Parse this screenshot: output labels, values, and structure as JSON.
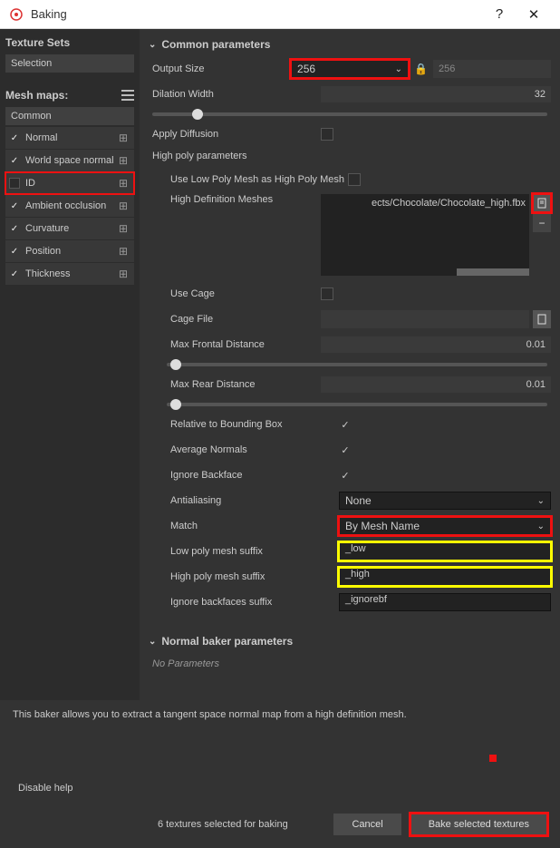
{
  "window": {
    "title": "Baking"
  },
  "sidebar": {
    "texture_sets_label": "Texture Sets",
    "selection": "Selection",
    "meshmaps_label": "Mesh maps:",
    "group_label": "Common",
    "maps": [
      {
        "label": "Normal",
        "checked": true
      },
      {
        "label": "World space normal",
        "checked": true
      },
      {
        "label": "ID",
        "checked": false
      },
      {
        "label": "Ambient occlusion",
        "checked": true
      },
      {
        "label": "Curvature",
        "checked": true
      },
      {
        "label": "Position",
        "checked": true
      },
      {
        "label": "Thickness",
        "checked": true
      }
    ]
  },
  "sections": {
    "common_params": "Common parameters",
    "normal_baker": "Normal baker parameters",
    "no_params": "No Parameters"
  },
  "params": {
    "output_size_label": "Output Size",
    "output_size_value": "256",
    "output_size_locked": "256",
    "dilation_label": "Dilation Width",
    "dilation_value": "32",
    "apply_diffusion_label": "Apply Diffusion",
    "high_poly_params": "High poly parameters",
    "use_low_as_high_label": "Use Low Poly Mesh as High Poly Mesh",
    "high_def_meshes_label": "High Definition Meshes",
    "mesh_path_display": "ects/Chocolate/Chocolate_high.fbx",
    "use_cage_label": "Use Cage",
    "cage_file_label": "Cage File",
    "max_frontal_label": "Max Frontal Distance",
    "max_frontal_value": "0.01",
    "max_rear_label": "Max Rear Distance",
    "max_rear_value": "0.01",
    "relative_bb_label": "Relative to Bounding Box",
    "relative_bb_checked": true,
    "avg_normals_label": "Average Normals",
    "avg_normals_checked": true,
    "ignore_backface_label": "Ignore Backface",
    "ignore_backface_checked": true,
    "antialiasing_label": "Antialiasing",
    "antialiasing_value": "None",
    "match_label": "Match",
    "match_value": "By Mesh Name",
    "low_suffix_label": "Low poly mesh suffix",
    "low_suffix_value": "_low",
    "high_suffix_label": "High poly mesh suffix",
    "high_suffix_value": "_high",
    "ignore_bf_suffix_label": "Ignore backfaces suffix",
    "ignore_bf_suffix_value": "_ignorebf"
  },
  "footer": {
    "description": "This baker allows you to extract a tangent space normal map from a high definition mesh.",
    "disable_help": "Disable help",
    "status": "6 textures selected for baking",
    "cancel": "Cancel",
    "bake": "Bake selected textures"
  }
}
